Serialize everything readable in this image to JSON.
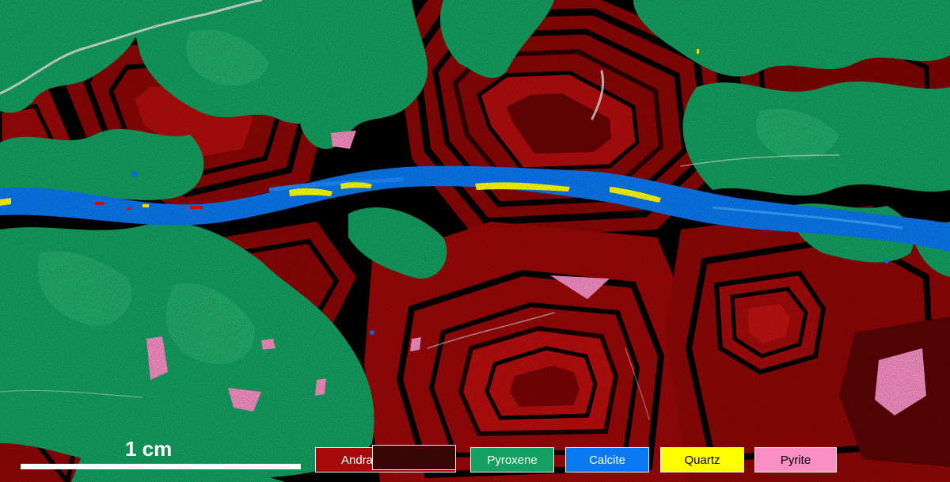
{
  "scale_bar": {
    "label": "1 cm"
  },
  "legend": {
    "andradite": {
      "label": "Andradite",
      "color": "#a60a0a",
      "color_dark": "#3a0707"
    },
    "pyroxene": {
      "label": "Pyroxene",
      "color": "#14a061"
    },
    "calcite": {
      "label": "Calcite",
      "color": "#0a78f0"
    },
    "quartz": {
      "label": "Quartz",
      "color": "#ffff00"
    },
    "pyrite": {
      "label": "Pyrite",
      "color": "#f78fc5"
    }
  },
  "palette": {
    "background": "#000000",
    "andradite_bright": "#c81010",
    "pyroxene_light": "#26b06e",
    "fracture": "#e8e8e8"
  }
}
